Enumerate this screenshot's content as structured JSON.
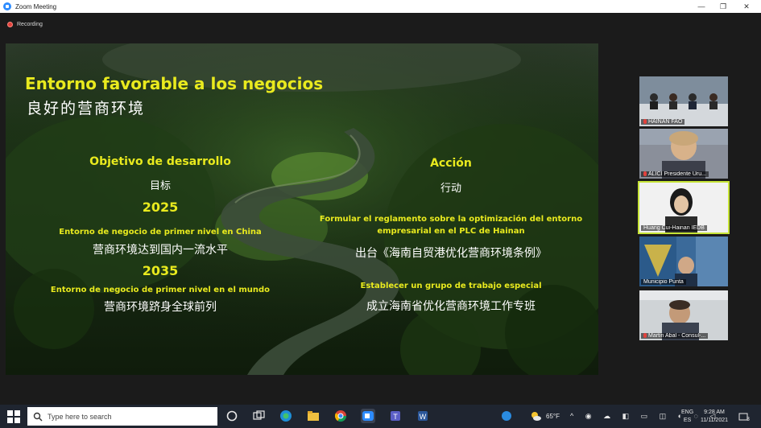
{
  "window": {
    "title": "Zoom Meeting",
    "minimize": "—",
    "restore": "❐",
    "close": "✕"
  },
  "recording": {
    "label": "Recording"
  },
  "slide": {
    "title_es": "Entorno favorable a los negocios",
    "title_zh": "良好的营商环境",
    "left": {
      "heading": "Objetivo de desarrollo",
      "heading_zh": "目标",
      "year1": "2025",
      "goal1": "Entorno de negocio de primer nivel en China",
      "goal1_zh": "营商环境达到国内一流水平",
      "year2": "2035",
      "goal2": "Entorno de negocio de primer nivel en el mundo",
      "goal2_zh": "营商环境跻身全球前列"
    },
    "right": {
      "heading": "Acción",
      "heading_zh": "行动",
      "action1_line1": "Formular el reglamento sobre la optimización del entorno",
      "action1_line2": "empresarial en el PLC de Hainan",
      "action1_zh": "出台《海南自贸港优化营商环境条例》",
      "action2": "Establecer un grupo de trabajo especial",
      "action2_zh": "成立海南省优化营商环境工作专班"
    }
  },
  "participants": [
    {
      "name": "HAINAN FAO",
      "muted": true
    },
    {
      "name": "ALICI Presidente Uru...",
      "muted": true
    },
    {
      "name": "Huang Cui-Hainan IEDB",
      "muted": false,
      "active": true
    },
    {
      "name": "Municipio Punta",
      "muted": false
    },
    {
      "name": "Martin Abal - Consul-...",
      "muted": true
    }
  ],
  "taskbar": {
    "search_placeholder": "Type here to search",
    "weather": "65°F",
    "lang_top": "ENG",
    "lang_bottom": "ES",
    "time": "9:28 AM",
    "date": "11/11/2021",
    "notifications": "3"
  },
  "colors": {
    "accent_yellow": "#e9ea1e",
    "active_tile": "#c6e336",
    "recording_red": "#e2413c"
  }
}
